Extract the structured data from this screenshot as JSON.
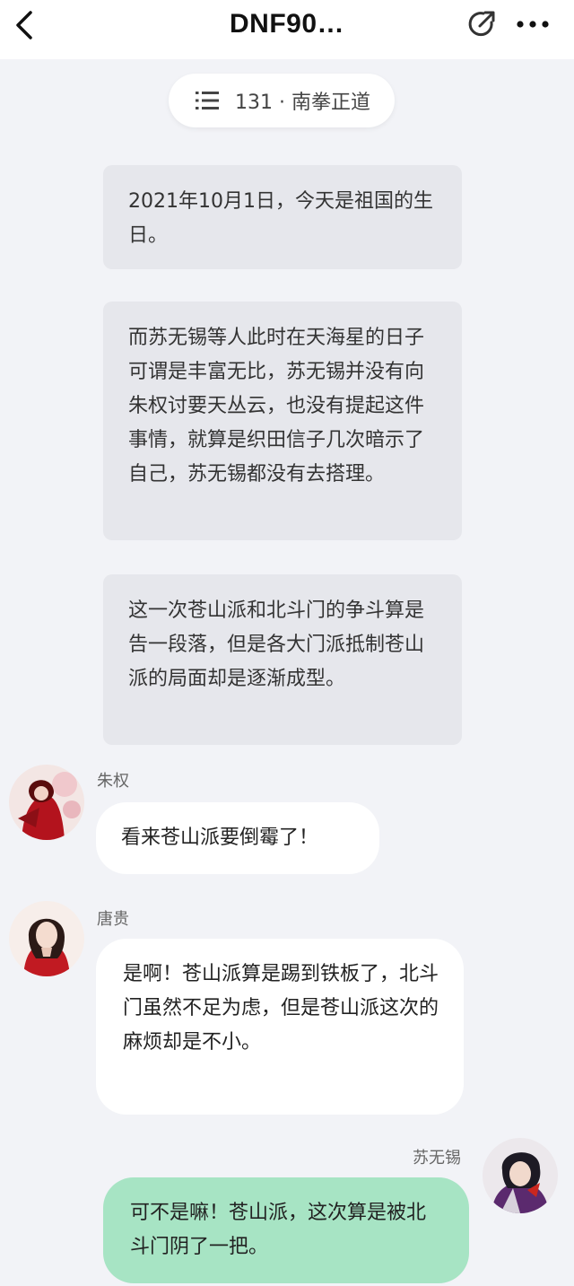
{
  "header": {
    "title": "DNF90…",
    "back_icon": "chevron-left-icon",
    "share_icon": "share-icon",
    "more_icon": "more-dots-icon"
  },
  "chapter": {
    "label": "131 · 南拳正道",
    "icon": "list-icon"
  },
  "narration": [
    "2021年10月1日，今天是祖国的生日。",
    "而苏无锡等人此时在天海星的日子可谓是丰富无比，苏无锡并没有向朱权讨要天丛云，也没有提起这件事情，就算是织田信子几次暗示了自己，苏无锡都没有去搭理。",
    "这一次苍山派和北斗门的争斗算是告一段落，但是各大门派抵制苍山派的局面却是逐渐成型。"
  ],
  "messages": [
    {
      "speaker": "朱权",
      "text": "看来苍山派要倒霉了！",
      "side": "left"
    },
    {
      "speaker": "唐贵",
      "text": "是啊！苍山派算是踢到铁板了，北斗门虽然不足为虑，但是苍山派这次的麻烦却是不小。",
      "side": "left"
    },
    {
      "speaker": "苏无锡",
      "text": "可不是嘛！苍山派，这次算是被北斗门阴了一把。",
      "side": "right"
    }
  ],
  "colors": {
    "background": "#f2f3f7",
    "narration_bubble": "#e6e7ec",
    "left_bubble": "#ffffff",
    "right_bubble": "#a7e4c4"
  }
}
